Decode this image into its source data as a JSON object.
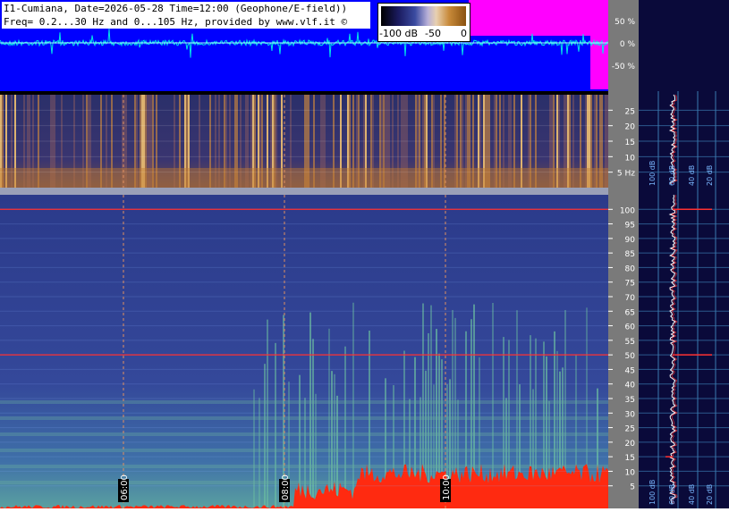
{
  "header": {
    "line1": "I1-Cumiana, Date=2026-05-28 Time=12:00 (Geophone/E-field))",
    "line2": "Freq= 0.2...30 Hz and 0...105 Hz, provided by www.vlf.it ©"
  },
  "colorbar": {
    "labels": [
      "-100 dB",
      "-50",
      "0"
    ]
  },
  "chart_data": [
    {
      "type": "line",
      "panel": "waveform",
      "y_ticks": [
        50,
        0,
        -50
      ],
      "y_tick_labels": [
        "50 %",
        "0 %",
        "-50 %"
      ],
      "ylim": [
        -100,
        100
      ],
      "colors": {
        "background": "#0000ff",
        "trace": "#00e6e6",
        "overrange": "#ff00ff"
      }
    },
    {
      "type": "heatmap",
      "panel": "spectrogram-low",
      "freq_unit": "Hz",
      "ylim": [
        0,
        30
      ],
      "y_ticks": [
        25,
        20,
        15,
        10,
        5
      ],
      "y_tick_labels": [
        "25",
        "20",
        "15",
        "10",
        "5 Hz"
      ],
      "spectrum_x_labels": [
        "100 dB",
        "60 dB",
        "40 dB",
        "20 dB"
      ]
    },
    {
      "type": "heatmap",
      "panel": "spectrogram-high",
      "ylim": [
        0,
        105
      ],
      "y_ticks": [
        100,
        95,
        90,
        85,
        80,
        75,
        70,
        65,
        60,
        55,
        50,
        45,
        40,
        35,
        30,
        25,
        20,
        15,
        10,
        5
      ],
      "spectrum_x_labels": [
        "100 dB",
        "60 dB",
        "40 dB",
        "20 dB"
      ],
      "lines_hz": [
        100,
        50
      ],
      "spectrum_peaks_hz": [
        100,
        50,
        15
      ]
    }
  ],
  "time_markers": [
    "06:00",
    "08:00",
    "10:00"
  ]
}
